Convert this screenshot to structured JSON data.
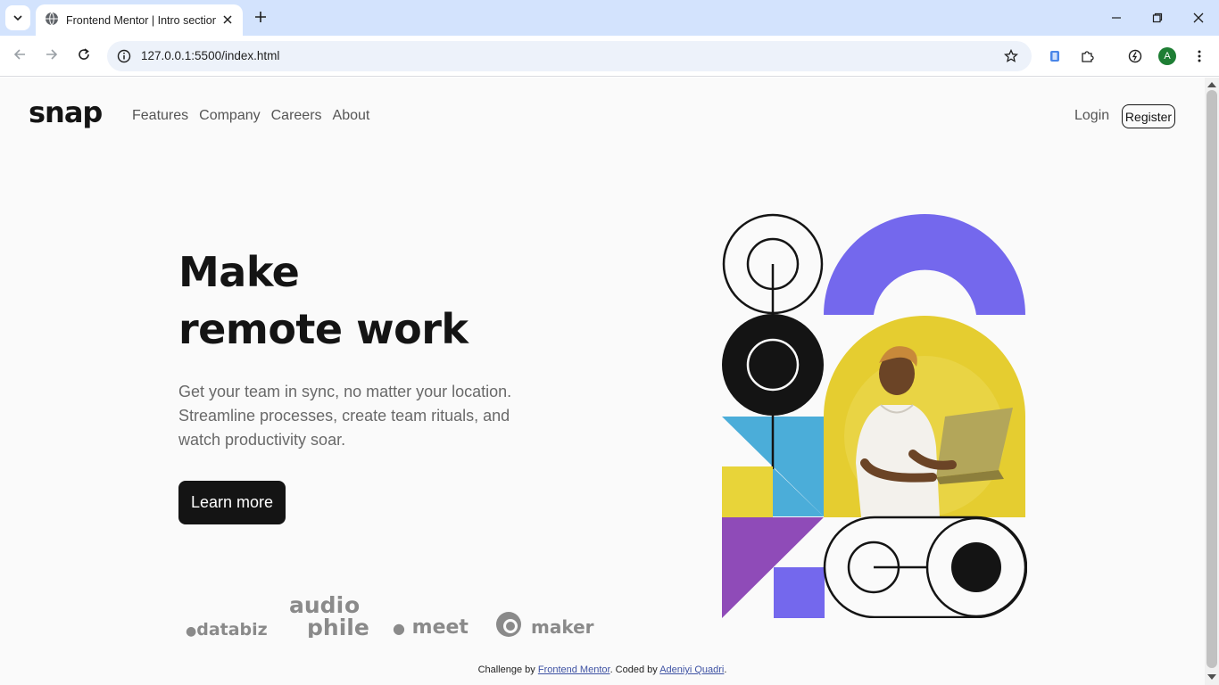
{
  "browser": {
    "tab_title": "Frontend Mentor | Intro section",
    "url": "127.0.0.1:5500/index.html",
    "profile_initial": "A",
    "accent": "#d3e3fd"
  },
  "page": {
    "logo": "snap",
    "nav": [
      "Features",
      "Company",
      "Careers",
      "About"
    ],
    "login": "Login",
    "register": "Register",
    "headline_line1": "Make",
    "headline_line2": "remote work",
    "subtext": "Get your team in sync, no matter your location. Streamline processes, create team rituals, and watch productivity soar.",
    "cta": "Learn more",
    "clients": [
      "databiz",
      "audiophile",
      "meet",
      "maker"
    ],
    "footer_prefix": "Challenge by ",
    "footer_link1": "Frontend Mentor",
    "footer_middle": ". Coded by ",
    "footer_link2": "Adeniyi Quadri",
    "footer_suffix": "."
  },
  "colors": {
    "dark": "#141414",
    "purple": "#7468ed",
    "yellow": "#e8d439",
    "blue": "#4badd9",
    "violet": "#8f4bb8"
  }
}
